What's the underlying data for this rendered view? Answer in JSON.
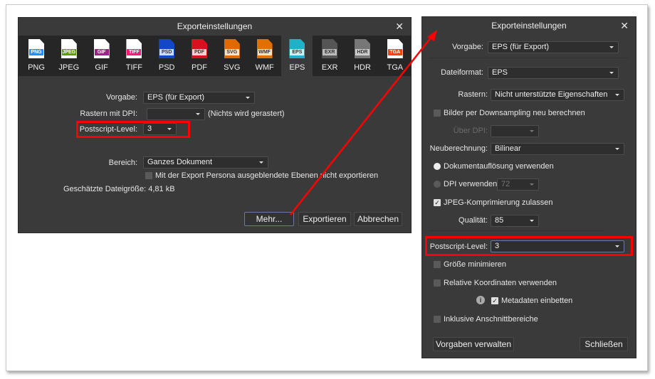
{
  "left_dialog": {
    "title": "Exporteinstellungen",
    "close": "✕",
    "formats": [
      {
        "label": "PNG",
        "tag": "PNG",
        "doc": "#ffffff",
        "tagc": "#1e90ff"
      },
      {
        "label": "JPEG",
        "tag": "JPEG",
        "doc": "#ffffff",
        "tagc": "#5aa000"
      },
      {
        "label": "GIF",
        "tag": "GIF",
        "doc": "#ffffff",
        "tagc": "#a0208c"
      },
      {
        "label": "TIFF",
        "tag": "TIFF",
        "doc": "#ffffff",
        "tagc": "#ff1a7a"
      },
      {
        "label": "PSD",
        "tag": "PSD",
        "doc": "#1446c8",
        "tagc": "#c8dcff"
      },
      {
        "label": "PDF",
        "tag": "PDF",
        "doc": "#d81020",
        "tagc": "#ffd0d0"
      },
      {
        "label": "SVG",
        "tag": "SVG",
        "doc": "#e06a00",
        "tagc": "#ffe0c0"
      },
      {
        "label": "WMF",
        "tag": "WMF",
        "doc": "#e07000",
        "tagc": "#ffe0c0"
      },
      {
        "label": "EPS",
        "tag": "EPS",
        "doc": "#20b0c8",
        "tagc": "#c8f0f8"
      },
      {
        "label": "EXR",
        "tag": "EXR",
        "doc": "#555555",
        "tagc": "#bbbbbb"
      },
      {
        "label": "HDR",
        "tag": "HDR",
        "doc": "#777777",
        "tagc": "#cccccc"
      },
      {
        "label": "TGA",
        "tag": "TGA",
        "doc": "#ffffff",
        "tagc": "#ff4010"
      }
    ],
    "selected_format": "EPS",
    "vorgabe_label": "Vorgabe:",
    "vorgabe_value": "EPS (für Export)",
    "raster_label": "Rastern mit DPI:",
    "raster_value": "",
    "raster_note": "(Nichts wird gerastert)",
    "ps_label": "Postscript-Level:",
    "ps_value": "3",
    "bereich_label": "Bereich:",
    "bereich_value": "Ganzes Dokument",
    "hide_layers": "Mit der Export Persona ausgeblendete Ebenen nicht exportieren",
    "filesize": "Geschätzte Dateigröße: 4,81 kB",
    "more": "Mehr...",
    "export": "Exportieren",
    "cancel": "Abbrechen"
  },
  "right_dialog": {
    "title": "Exporteinstellungen",
    "close": "✕",
    "vorgabe_label": "Vorgabe:",
    "vorgabe_value": "EPS (für Export)",
    "format_label": "Dateiformat:",
    "format_value": "EPS",
    "raster_label": "Rastern:",
    "raster_value": "Nicht unterstützte Eigenschaften",
    "downsample": "Bilder per Downsampling neu berechnen",
    "above_dpi_label": "Über DPI:",
    "above_dpi_value": "",
    "resample_label": "Neuberechnung:",
    "resample_value": "Bilinear",
    "doc_res": "Dokumentauflösung verwenden",
    "dpi_label": "DPI verwenden:",
    "dpi_value": "72",
    "jpeg": "JPEG-Komprimierung zulassen",
    "quality_label": "Qualität:",
    "quality_value": "85",
    "ps_label": "Postscript-Level:",
    "ps_value": "3",
    "minimize": "Größe minimieren",
    "relative": "Relative Koordinaten verwenden",
    "info": "i",
    "metadata": "Metadaten einbetten",
    "bleed": "Inklusive Anschnittbereiche",
    "manage": "Vorgaben verwalten",
    "closebtn": "Schließen"
  }
}
